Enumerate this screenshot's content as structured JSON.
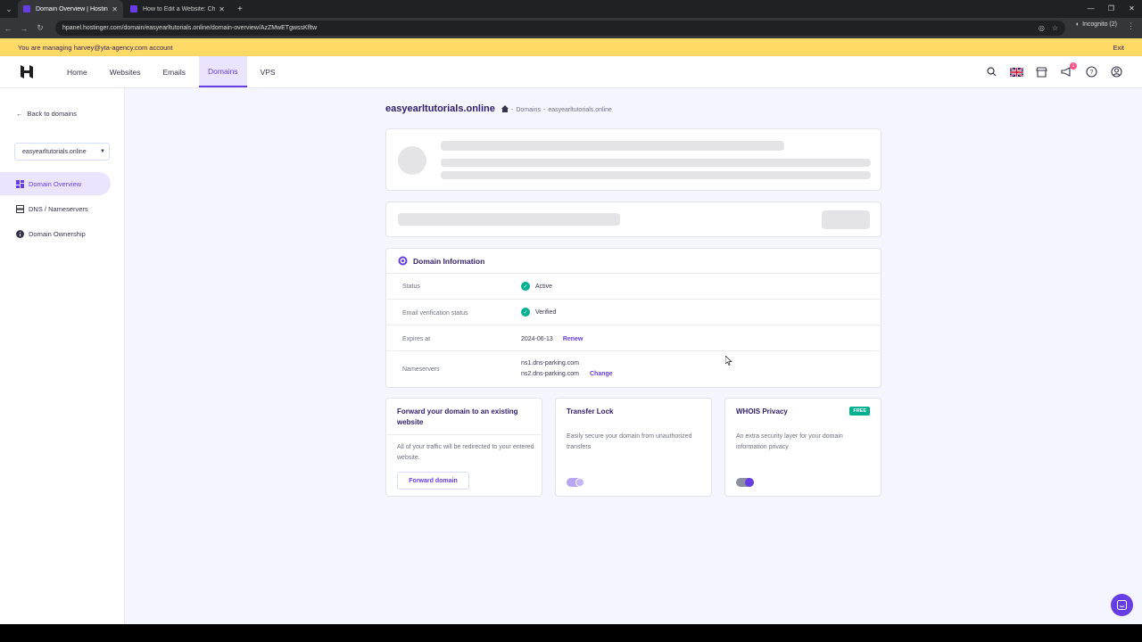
{
  "browser": {
    "tabs": [
      {
        "title": "Domain Overview | Hostinger",
        "active": true
      },
      {
        "title": "How to Edit a Website: Change",
        "active": false
      }
    ],
    "url": "hpanel.hostinger.com/domain/easyearltutorials.online/domain-overview/AzZMwETgwssKfltw",
    "incognito_label": "Incognito (2)"
  },
  "banner": {
    "text": "You are managing harvey@yta-agency.com account",
    "exit_label": "Exit"
  },
  "topnav": {
    "items": [
      "Home",
      "Websites",
      "Emails",
      "Domains",
      "VPS"
    ],
    "active": "Domains",
    "notification_count": "1"
  },
  "sidebar": {
    "back_label": "Back to domains",
    "domain_selector": "easyearltutorials.online",
    "items": [
      "Domain Overview",
      "DNS / Nameservers",
      "Domain Ownership"
    ],
    "active": "Domain Overview"
  },
  "main": {
    "title": "easyearltutorials.online",
    "breadcrumb": [
      "Domains",
      "easyearltutorials.online"
    ]
  },
  "domain_info": {
    "heading": "Domain Information",
    "status_label": "Status",
    "status_value": "Active",
    "email_label": "Email verification status",
    "email_value": "Verified",
    "expires_label": "Expires at",
    "expires_value": "2024-06-13",
    "renew_label": "Renew",
    "ns_label": "Nameservers",
    "ns1": "ns1.dns-parking.com",
    "ns2": "ns2.dns-parking.com",
    "change_label": "Change"
  },
  "forward_card": {
    "title": "Forward your domain to an existing website",
    "text": "All of your traffic will be redirected to your entered website.",
    "button": "Forward domain"
  },
  "transfer_card": {
    "title": "Transfer Lock",
    "text": "Easily secure your domain from unauthorized transfers",
    "enabled": true
  },
  "whois_card": {
    "title": "WHOIS Privacy",
    "badge": "FREE",
    "text": "An extra security layer for your domain information privacy",
    "enabled": true
  },
  "colors": {
    "brand": "#673de6",
    "banner": "#fdda65",
    "success": "#00b090"
  }
}
